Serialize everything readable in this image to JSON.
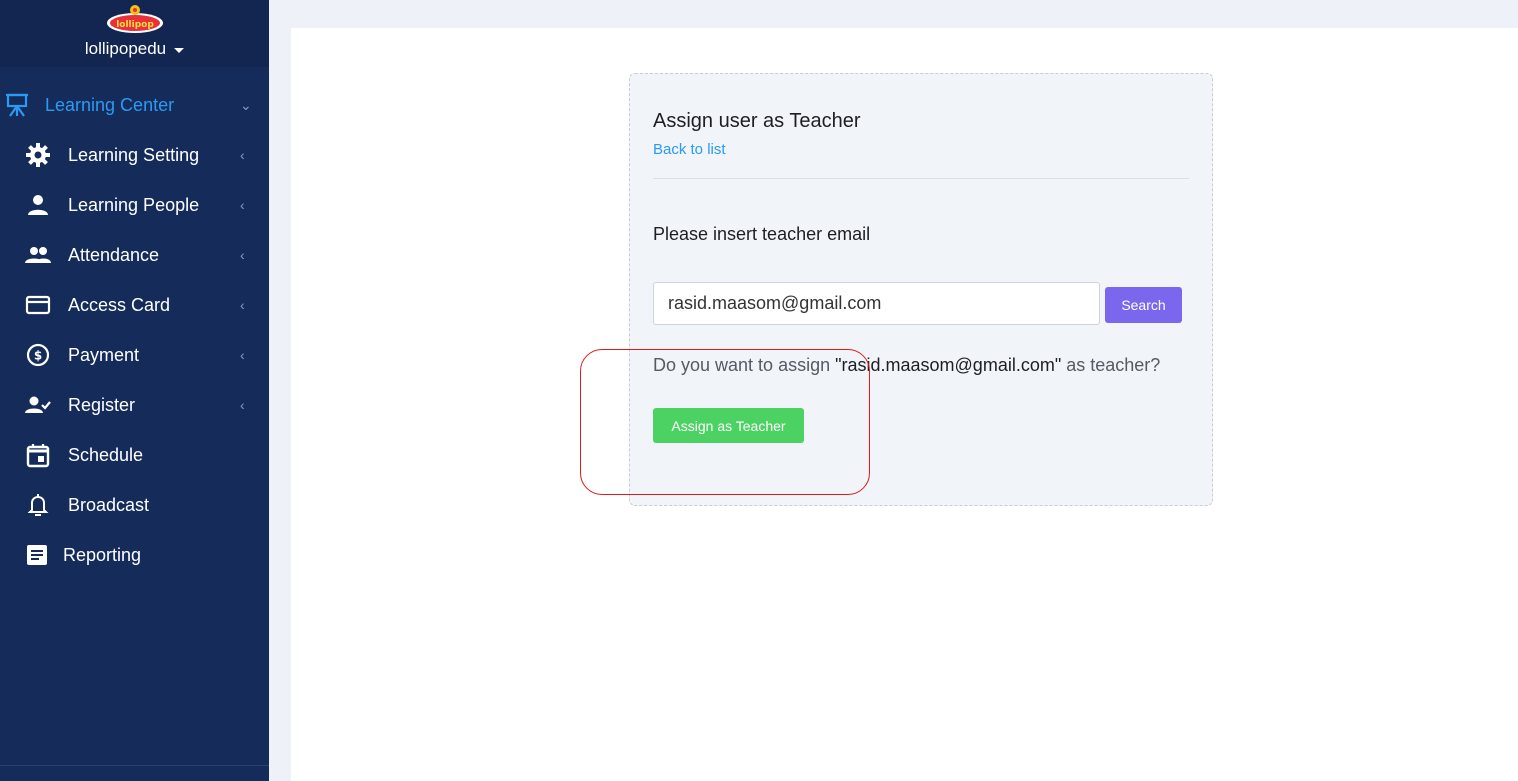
{
  "brand": {
    "name": "lollipopedu",
    "logo_text": "lollipop"
  },
  "sidebar": {
    "items": [
      {
        "label": "Learning Center",
        "icon": "easel-icon",
        "active": true,
        "chevron": "⌄"
      },
      {
        "label": "Learning Setting",
        "icon": "gear-icon",
        "chevron": "‹"
      },
      {
        "label": "Learning People",
        "icon": "person-icon",
        "chevron": "‹"
      },
      {
        "label": "Attendance",
        "icon": "people-icon",
        "chevron": "‹"
      },
      {
        "label": "Access Card",
        "icon": "card-icon",
        "chevron": "‹"
      },
      {
        "label": "Payment",
        "icon": "dollar-coin-icon",
        "chevron": "‹"
      },
      {
        "label": "Register",
        "icon": "person-check-icon",
        "chevron": "‹"
      },
      {
        "label": "Schedule",
        "icon": "calendar-icon"
      },
      {
        "label": "Broadcast",
        "icon": "bell-icon"
      },
      {
        "label": "Reporting",
        "icon": "document-icon"
      }
    ]
  },
  "card": {
    "title": "Assign user as Teacher",
    "back_link": "Back to list",
    "prompt": "Please insert teacher email",
    "email_value": "rasid.maasom@gmail.com",
    "search_label": "Search",
    "question_prefix": "Do you want to assign ",
    "question_email": "\"rasid.maasom@gmail.com\"",
    "question_suffix": " as teacher?",
    "assign_label": "Assign as Teacher"
  },
  "colors": {
    "sidebar_bg": "#152c5b",
    "accent_blue": "#2b9af3",
    "search_purple": "#7b66ee",
    "assign_green": "#4cd263",
    "highlight_red": "#e01a1a"
  }
}
